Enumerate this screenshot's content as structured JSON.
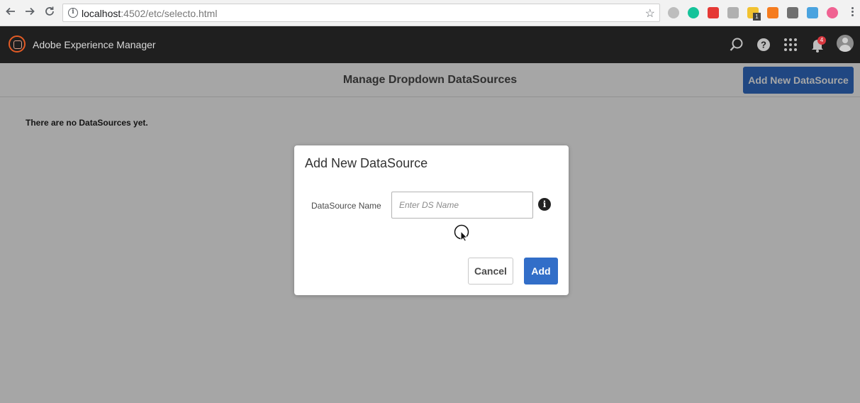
{
  "browser": {
    "url_host": "localhost",
    "url_rest": ":4502/etc/selecto.html",
    "back_icon": "arrow-left-icon",
    "forward_icon": "arrow-right-icon",
    "reload_icon": "reload-icon",
    "bookmark_icon": "star-icon",
    "extensions": [
      {
        "name": "puzzle-extension-icon",
        "color": "#bdbdbd"
      },
      {
        "name": "grammarly-extension-icon",
        "color": "#15c39a"
      },
      {
        "name": "red-extension-icon",
        "color": "#e53935"
      },
      {
        "name": "grey-extension-icon",
        "color": "#b0b0b0"
      },
      {
        "name": "yellow-extension-icon",
        "color": "#f2c230"
      },
      {
        "name": "orange-extension-icon",
        "color": "#f57c1f"
      },
      {
        "name": "dark-extension-icon",
        "color": "#707070"
      },
      {
        "name": "blue-extension-icon",
        "color": "#4aa3df"
      },
      {
        "name": "pink-extension-icon",
        "color": "#f06292"
      }
    ],
    "extension_badge": "1"
  },
  "header": {
    "app_title": "Adobe Experience Manager",
    "notification_count": "4"
  },
  "page": {
    "title": "Manage Dropdown DataSources",
    "add_button_label": "Add New DataSource",
    "empty_message": "There are no DataSources yet."
  },
  "dialog": {
    "title": "Add New DataSource",
    "field_label": "DataSource Name",
    "field_value": "",
    "field_placeholder": "Enter DS Name",
    "info_glyph": "i",
    "cancel_label": "Cancel",
    "add_label": "Add"
  },
  "colors": {
    "accent": "#326ec8",
    "header_bg": "#1f1f1f",
    "notification_badge": "#d7373f"
  }
}
